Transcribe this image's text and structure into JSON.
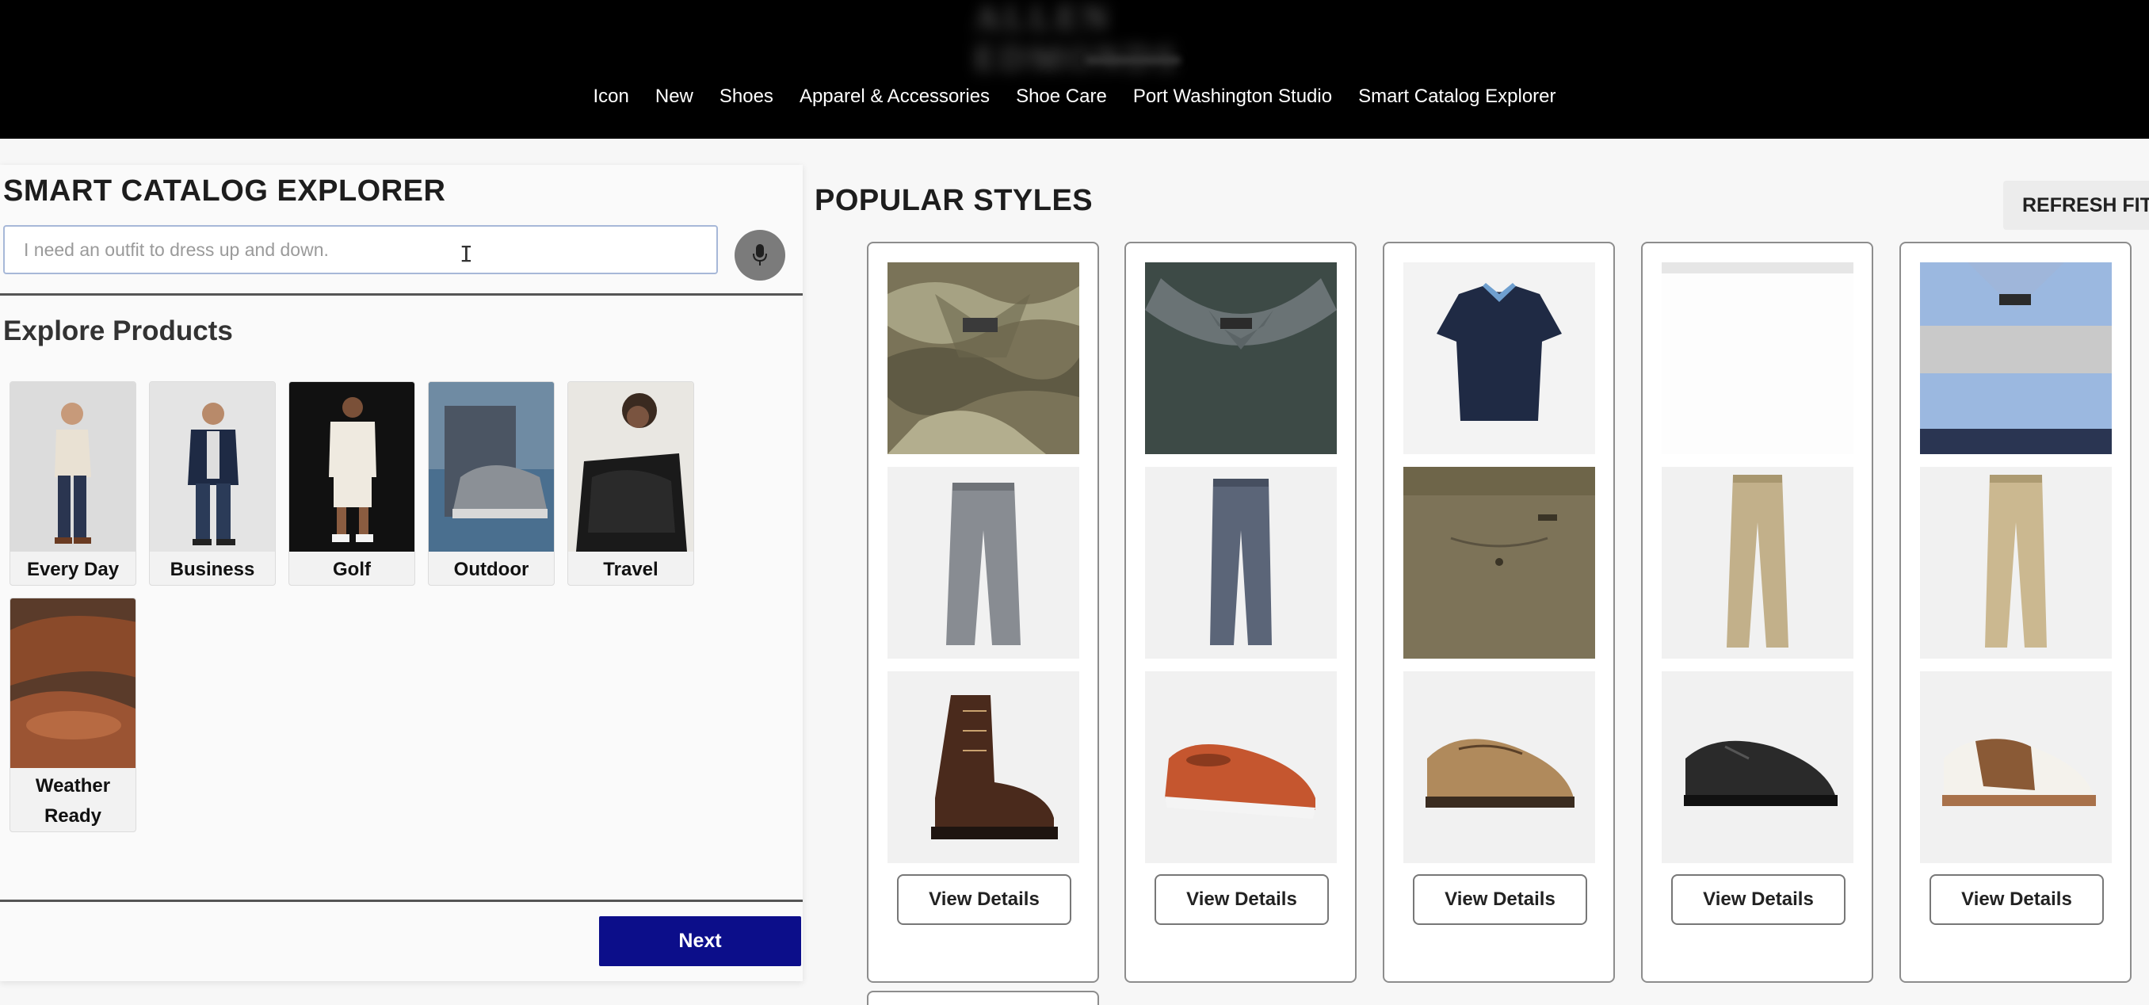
{
  "header": {
    "brand": "ALLEN EDMONDS",
    "nav": [
      "Icon",
      "New",
      "Shoes",
      "Apparel & Accessories",
      "Shoe Care",
      "Port Washington Studio",
      "Smart Catalog Explorer"
    ]
  },
  "explorer": {
    "title": "SMART CATALOG EXPLORER",
    "search_placeholder": "I need an outfit to dress up and down.",
    "explore_heading": "Explore Products",
    "categories": [
      "Every Day",
      "Business",
      "Golf",
      "Outdoor",
      "Travel",
      "Weather Ready"
    ],
    "next_label": "Next"
  },
  "popular": {
    "heading": "POPULAR STYLES",
    "refresh_label": "REFRESH FIT",
    "view_details_label": "View Details",
    "cards": [
      {
        "top": "camo-print-shirt",
        "bottom": "gray-pants",
        "shoe": "brown-lace-up-boot"
      },
      {
        "top": "dark-green-polo",
        "bottom": "gray-jeans",
        "shoe": "red-slip-on-sneaker"
      },
      {
        "top": "navy-polo",
        "bottom": "olive-chino-shorts",
        "shoe": "tan-boat-shoe"
      },
      {
        "top": "",
        "bottom": "khaki-pants",
        "shoe": "black-derby-shoe"
      },
      {
        "top": "blue-stripe-polo",
        "bottom": "khaki-pants",
        "shoe": "brown-white-saddle-shoe"
      }
    ]
  },
  "colors": {
    "header_bg": "#000000",
    "next_button": "#0c0e8a",
    "mic_button": "#7b7b7b"
  }
}
